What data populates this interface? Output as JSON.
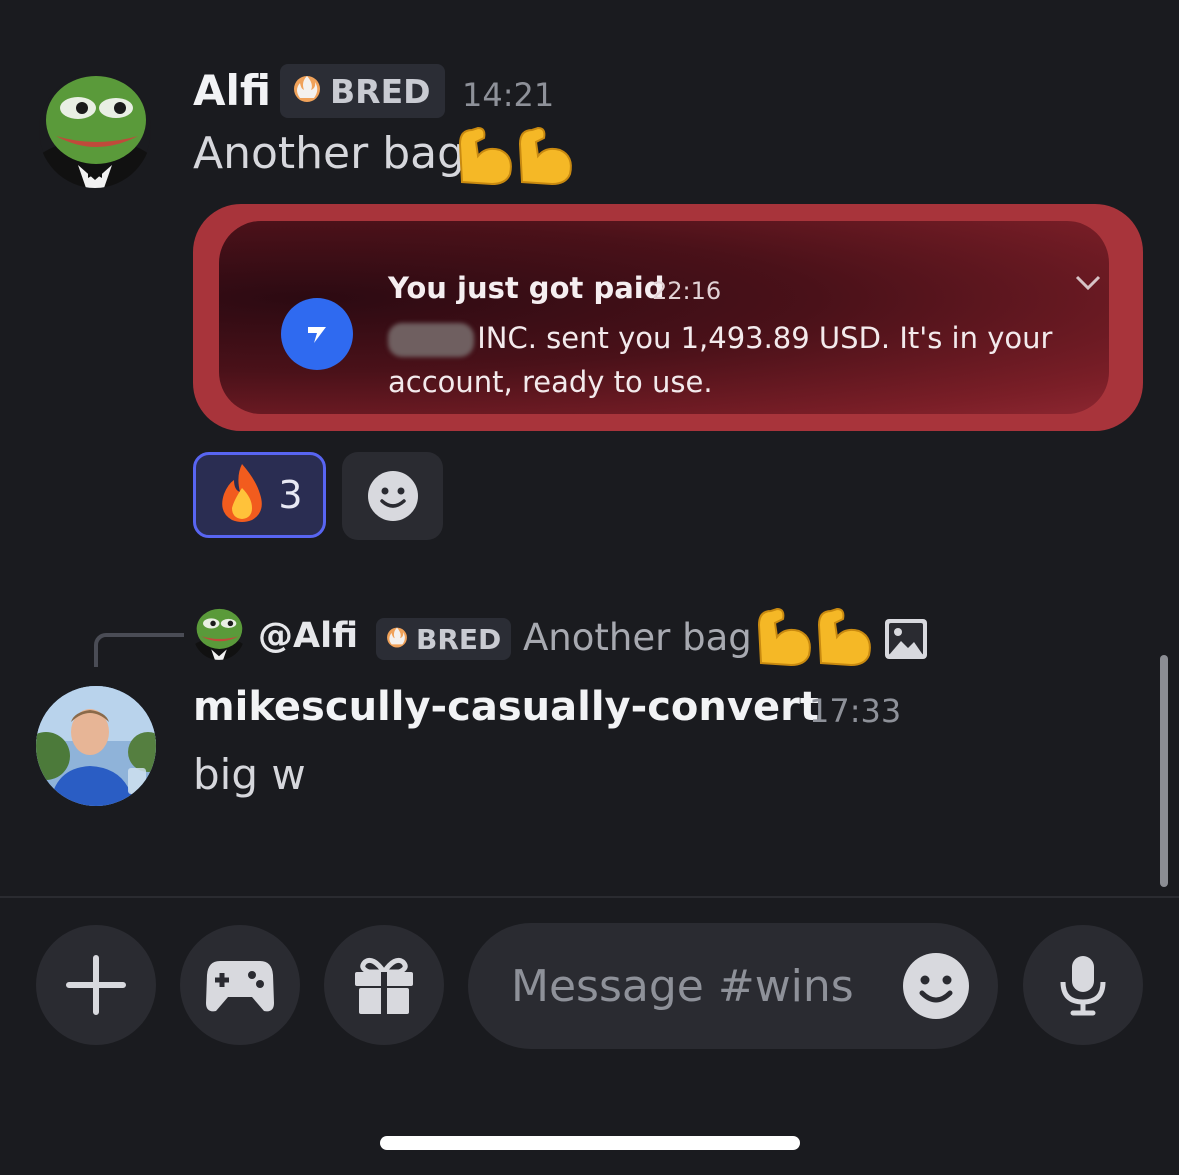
{
  "message1": {
    "username": "Alfi",
    "badge": "BRED",
    "timestamp": "14:21",
    "text": "Another bag",
    "emoji": "muscle-icon x2",
    "attachment": {
      "title": "You just got paid",
      "time": "22:16",
      "body": "INC. sent you 1,493.89 USD. It's in your account, ready to use."
    },
    "reaction": {
      "emoji": "fire-icon",
      "count": "3"
    }
  },
  "reply": {
    "username": "@Alfi",
    "badge": "BRED",
    "text": "Another bag"
  },
  "message2": {
    "username": "mikescully-casually-convert",
    "timestamp": "17:33",
    "text": "big w"
  },
  "composer": {
    "placeholder": "Message #wins"
  },
  "colors": {
    "background": "#1a1b1f",
    "accent": "#5865f2",
    "wise_blue": "#2f6af0"
  }
}
